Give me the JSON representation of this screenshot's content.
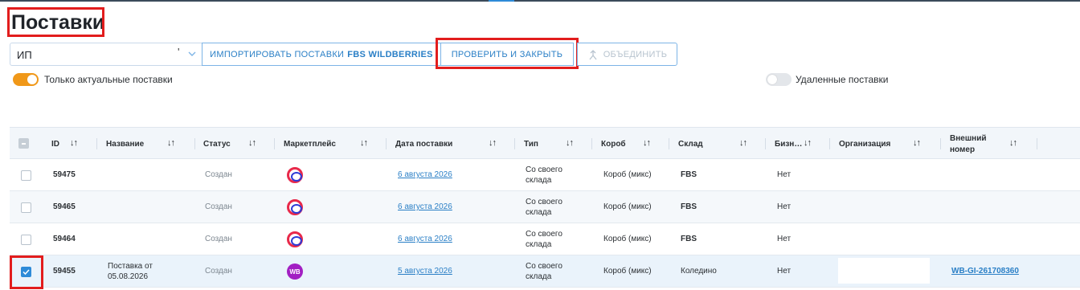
{
  "page": {
    "title": "Поставки"
  },
  "toolbar": {
    "org_select_value": "ИП",
    "org_select_suffix": "'",
    "import_label_prefix": "ИМПОРТИРОВАТЬ ПОСТАВКИ",
    "import_label_bold": "FBS WILDBERRIES",
    "check_close_label": "ПРОВЕРИТЬ И ЗАКРЫТЬ",
    "merge_label": "ОБЪЕДИНИТЬ"
  },
  "filters": {
    "actual_only": {
      "label": "Только актуальные поставки",
      "on": true
    },
    "deleted": {
      "label": "Удаленные поставки",
      "on": false
    }
  },
  "table": {
    "columns": [
      "ID",
      "Название",
      "Статус",
      "Маркетплейс",
      "Дата поставки",
      "Тип",
      "Короб",
      "Склад",
      "Бизн…",
      "Организация",
      "Внешний номер"
    ],
    "external_line1": "Внешний",
    "external_line2": "номер",
    "sort_glyph": "↓↑",
    "rows": [
      {
        "id": "59475",
        "name": "",
        "status": "Создан",
        "marketplace": "ozon-icon",
        "date": "6 августа 2026",
        "type_l1": "Со своего",
        "type_l2": "склада",
        "box": "Короб (микс)",
        "warehouse": "FBS",
        "business": "Нет",
        "external": "",
        "checked": false
      },
      {
        "id": "59465",
        "name": "",
        "status": "Создан",
        "marketplace": "ozon-icon",
        "date": "6 августа 2026",
        "type_l1": "Со своего",
        "type_l2": "склада",
        "box": "Короб (микс)",
        "warehouse": "FBS",
        "business": "Нет",
        "external": "",
        "checked": false
      },
      {
        "id": "59464",
        "name": "",
        "status": "Создан",
        "marketplace": "ozon-icon",
        "date": "6 августа 2026",
        "type_l1": "Со своего",
        "type_l2": "склада",
        "box": "Короб (микс)",
        "warehouse": "FBS",
        "business": "Нет",
        "external": "",
        "checked": false
      },
      {
        "id": "59455",
        "name_l1": "Поставка от",
        "name_l2": "05.08.2026",
        "status": "Создан",
        "marketplace": "wildberries-icon",
        "marketplace_text": "WB",
        "date": "5 августа 2026",
        "type_l1": "Со своего",
        "type_l2": "склада",
        "box": "Короб (микс)",
        "warehouse": "Коледино",
        "business": "Нет",
        "external": "WB-GI-261708360",
        "checked": true
      }
    ]
  },
  "colors": {
    "accent": "#2e8bd8",
    "toggle_on": "#f09819",
    "highlight": "#e21d1d",
    "wb_brand": "#a21fc3",
    "ozon_brand": "#e8294a"
  }
}
